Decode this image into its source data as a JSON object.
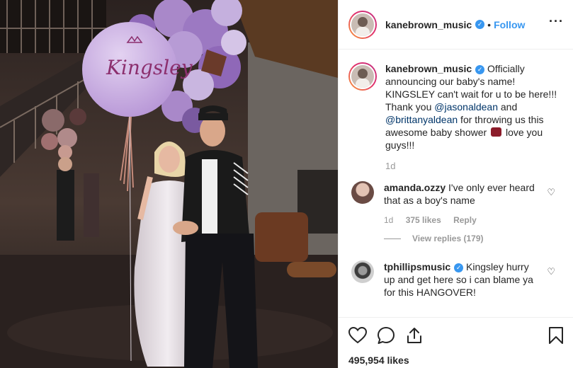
{
  "post": {
    "author": "kanebrown_music",
    "verified_glyph": "✓",
    "separator": "•",
    "follow_label": "Follow",
    "more_icon": "more-options-icon",
    "balloon_text": "Kingsley"
  },
  "caption": {
    "username": "kanebrown_music",
    "text_1": "Officially announcing our baby's name! KINGSLEY can't wait for u to be here!!! Thank you ",
    "mention_1": "@jasonaldean",
    "text_2": " and ",
    "mention_2": "@brittanyaldean",
    "text_3": " for throwing us this awesome baby shower ",
    "text_4": " love you guys!!!",
    "time": "1d"
  },
  "comments": [
    {
      "username": "amanda.ozzy",
      "text": "I've only ever heard that as a boy's name",
      "time": "1d",
      "likes": "375 likes",
      "reply": "Reply",
      "view_replies": "View replies (179)"
    },
    {
      "username": "tphillipsmusic",
      "text": "Kingsley hurry up and get here so i can blame ya for this HANGOVER!"
    }
  ],
  "actions": {
    "icons": [
      "heart-icon",
      "comment-icon",
      "share-icon",
      "bookmark-icon"
    ],
    "like_count": "495,954 likes"
  },
  "colors": {
    "link": "#3897f0",
    "mention": "#003569",
    "muted": "#999999",
    "balloon": "#c8aee0"
  }
}
